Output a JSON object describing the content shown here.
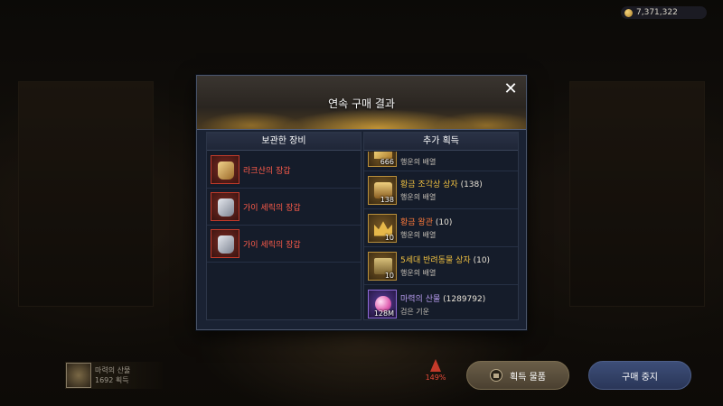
{
  "currency": {
    "icon": "coin-icon",
    "amount": "7,371,322"
  },
  "modal": {
    "title": "연속 구매 결과",
    "close_icon": "close-icon",
    "stored_equipment": {
      "header": "보관한 장비",
      "items": [
        {
          "name": "라크샨의 장갑",
          "icon": "gold-gauntlet-icon",
          "color": "#ff5c4a"
        },
        {
          "name": "가이 세릭의 장갑",
          "icon": "silver-gauntlet-icon",
          "color": "#ff5c4a"
        },
        {
          "name": "가이 세릭의 장갑",
          "icon": "silver-gauntlet-icon",
          "color": "#ff5c4a"
        }
      ]
    },
    "extra_acquired": {
      "header": "추가 획득",
      "items": [
        {
          "name": "",
          "count": "",
          "qty": "666",
          "sub": "행운의 배열",
          "icon": "gold-bar-icon",
          "name_color": "#f0c040"
        },
        {
          "name": "황금 조각상 상자",
          "count": "(138)",
          "qty": "138",
          "sub": "행운의 배열",
          "icon": "treasure-chest-icon",
          "name_color": "#f0c040"
        },
        {
          "name": "황금 왕관",
          "count": "(10)",
          "qty": "10",
          "sub": "행운의 배열",
          "icon": "crown-icon",
          "name_color": "#ff7a3a"
        },
        {
          "name": "5세대 반려동물 상자",
          "count": "(10)",
          "qty": "10",
          "sub": "행운의 배열",
          "icon": "pet-box-icon",
          "name_color": "#f0c040"
        },
        {
          "name": "마력의 산물",
          "count": "(1289792)",
          "qty": "128M",
          "sub": "검은 기운",
          "icon": "mana-orb-icon",
          "name_color": "#b89cf0"
        }
      ]
    }
  },
  "bottom_item": {
    "name": "마력의 산물",
    "count": "1692 획득"
  },
  "warning": {
    "value": "149%",
    "icon": "warning-icon"
  },
  "buttons": {
    "acquired_items": "획득 물품",
    "stop_purchase": "구매 중지"
  }
}
